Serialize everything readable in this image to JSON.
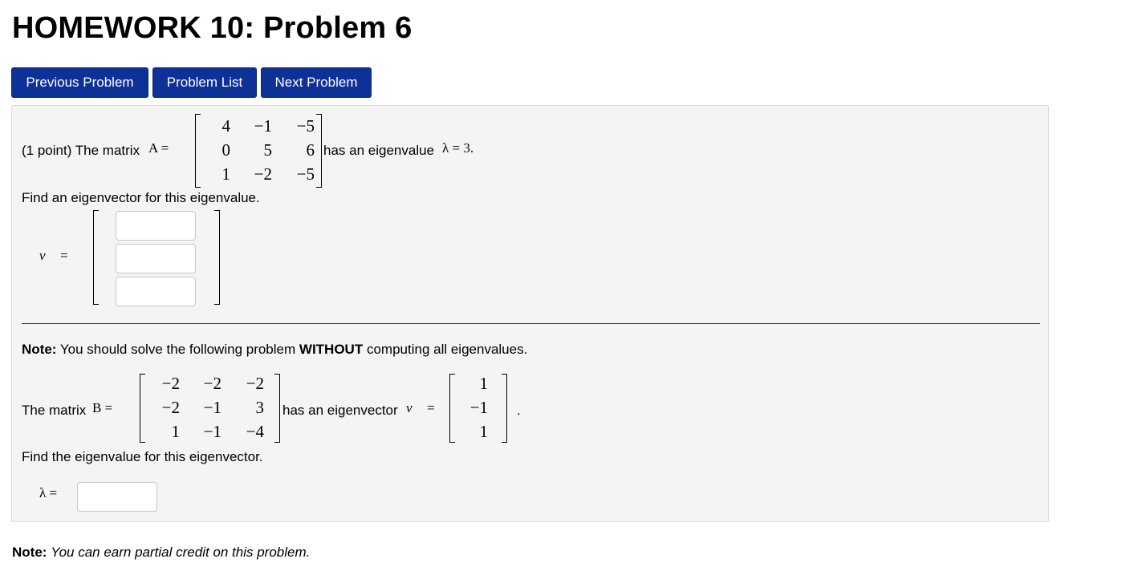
{
  "page_title": "HOMEWORK 10: Problem 6",
  "nav": {
    "previous": "Previous Problem",
    "list": "Problem List",
    "next": "Next Problem"
  },
  "problem": {
    "part1": {
      "intro": "(1 point) The matrix",
      "matrix_label": "A =",
      "matrix_A": [
        [
          "4",
          "−1",
          "−5"
        ],
        [
          "0",
          "5",
          "6"
        ],
        [
          "1",
          "−2",
          "−5"
        ]
      ],
      "eigen_text": "has an eigenvalue",
      "lambda_expr": "λ = 3.",
      "instruction": "Find an eigenvector for this eigenvalue.",
      "answer_label": "v⃗ =",
      "answer_values": [
        "",
        "",
        ""
      ]
    },
    "note": {
      "label": "Note:",
      "text_before": "You should solve the following problem",
      "emphasis": "WITHOUT",
      "text_after": "computing all eigenvalues."
    },
    "part2": {
      "intro": "The matrix",
      "matrix_label": "B =",
      "matrix_B": [
        [
          "−2",
          "−2",
          "−2"
        ],
        [
          "−2",
          "−1",
          "3"
        ],
        [
          "1",
          "−1",
          "−4"
        ]
      ],
      "eigen_text": "has an eigenvector",
      "vector_label": "v⃗ =",
      "vector_v": [
        "1",
        "−1",
        "1"
      ],
      "period": ".",
      "instruction": "Find the eigenvalue for this eigenvector.",
      "answer_label": "λ =",
      "answer_value": ""
    }
  },
  "footer": {
    "label": "Note:",
    "text": "You can earn partial credit on this problem."
  }
}
